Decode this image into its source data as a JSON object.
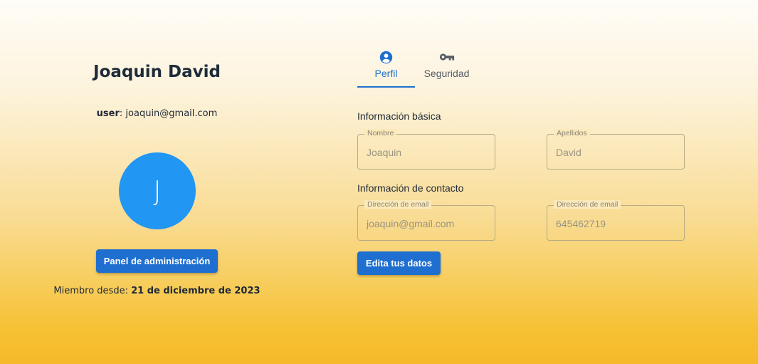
{
  "profile": {
    "name": "Joaquin David",
    "user_label": "user",
    "user_email": "joaquin@gmail.com",
    "avatar_letter": "J",
    "admin_button": "Panel de administración",
    "member_since_label": "Miembro desde:",
    "member_since_date": "21 de diciembre de 2023"
  },
  "tabs": [
    {
      "label": "Perfil",
      "icon": "account-circle-icon",
      "active": true
    },
    {
      "label": "Seguridad",
      "icon": "key-icon",
      "active": false
    }
  ],
  "basic_info": {
    "title": "Información básica",
    "fields": [
      {
        "label": "Nombre",
        "value": "Joaquin"
      },
      {
        "label": "Apellidos",
        "value": "David"
      }
    ]
  },
  "contact_info": {
    "title": "Información de contacto",
    "fields": [
      {
        "label": "Dirección de email",
        "value": "joaquin@gmail.com"
      },
      {
        "label": "Dirección de email",
        "value": "645462719"
      }
    ]
  },
  "edit_button": "Edita tus datos",
  "colors": {
    "accent": "#1e6fd0",
    "avatar": "#2196f3",
    "gradient_bottom": "#f5b929"
  }
}
